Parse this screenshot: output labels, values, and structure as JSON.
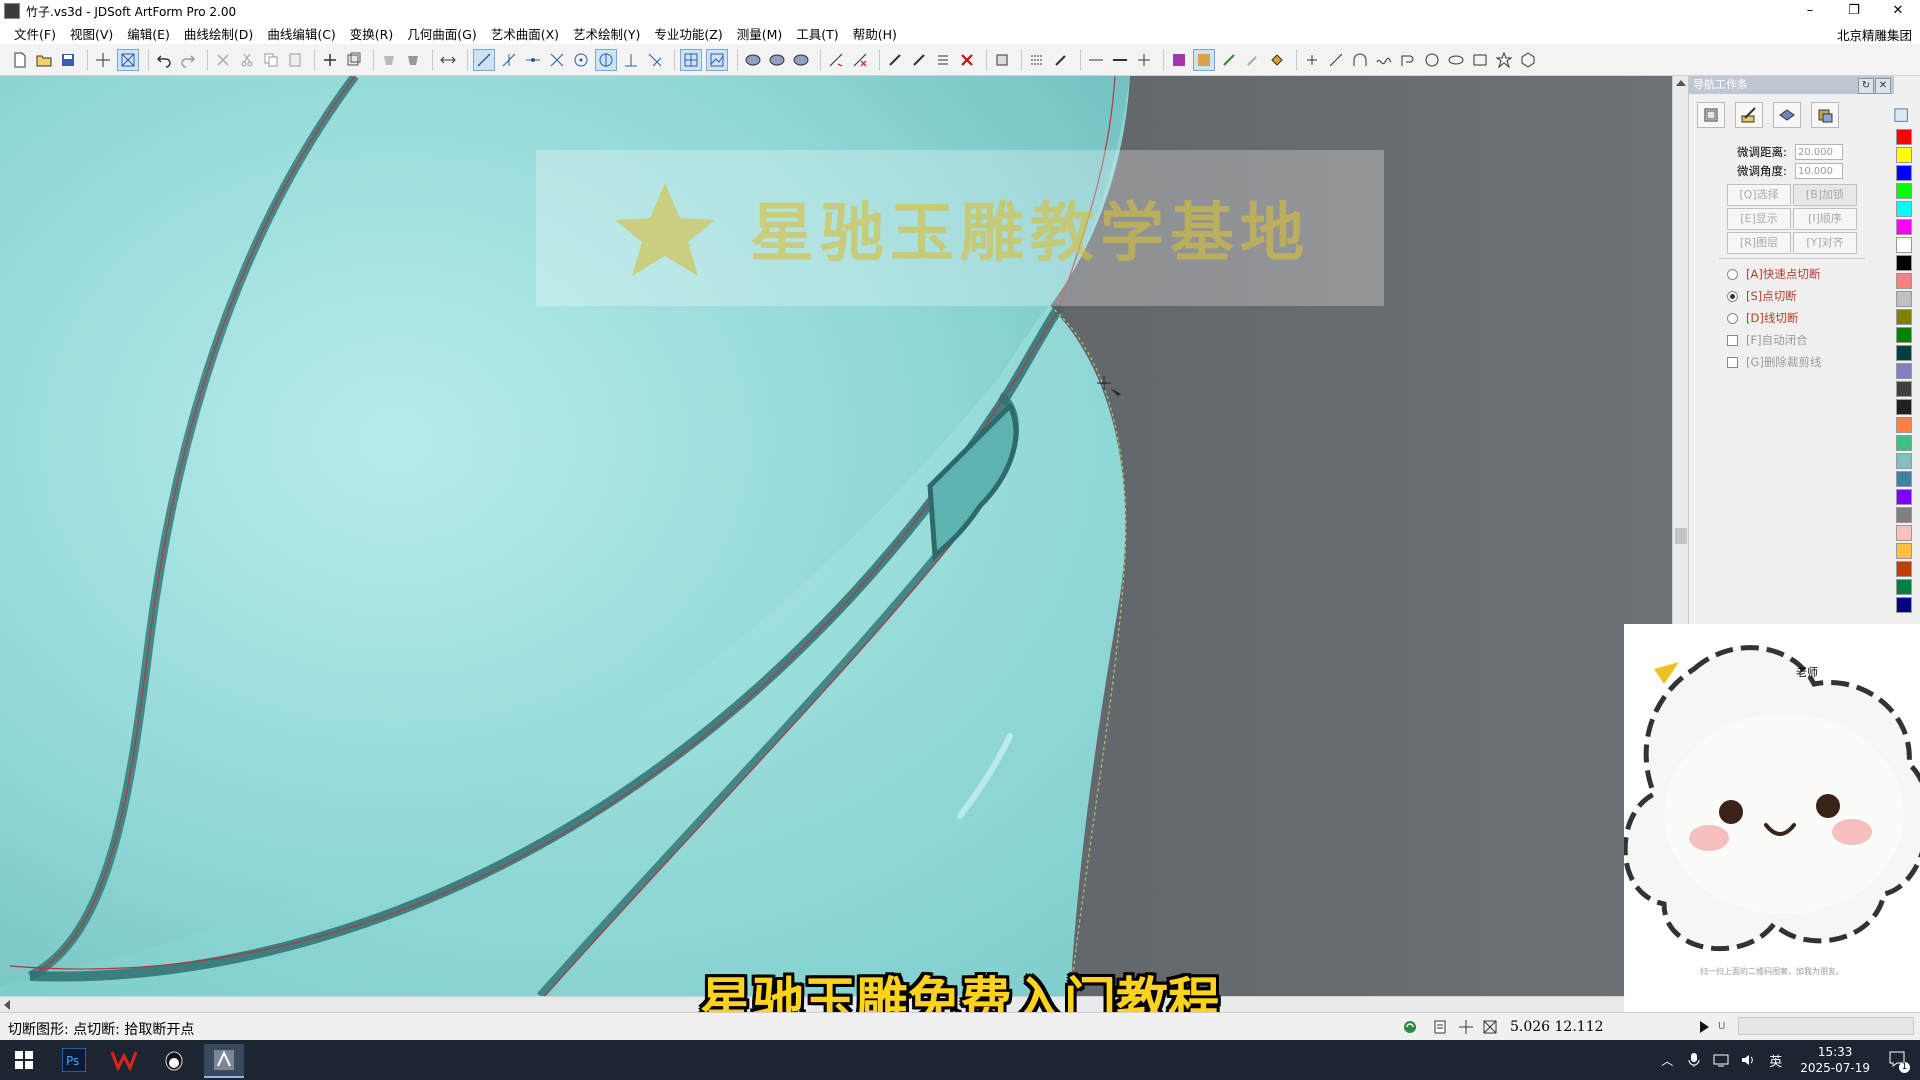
{
  "window": {
    "title": "竹子.vs3d - JDSoft ArtForm Pro 2.00",
    "controls": [
      "–",
      "❐",
      "✕"
    ]
  },
  "menu": {
    "items": [
      "文件(F)",
      "视图(V)",
      "编辑(E)",
      "曲线绘制(D)",
      "曲线编辑(C)",
      "变换(R)",
      "几何曲面(G)",
      "艺术曲面(X)",
      "艺术绘制(Y)",
      "专业功能(Z)",
      "测量(M)",
      "工具(T)",
      "帮助(H)"
    ],
    "company": "北京精雕集团"
  },
  "watermark": {
    "text": "星驰玉雕教学基地"
  },
  "panel": {
    "title": "导航工作条",
    "fields": [
      {
        "label": "微调距离:",
        "value": "20.000"
      },
      {
        "label": "微调角度:",
        "value": "10.000"
      }
    ],
    "buttons": [
      "[Q]选择",
      "[B]加锁",
      "[E]显示",
      "[I]顺序",
      "[R]图层",
      "[Y]对齐"
    ],
    "options": [
      {
        "label": "[A]快速点切断",
        "type": "radio",
        "checked": false,
        "active": true
      },
      {
        "label": "[S]点切断",
        "type": "radio",
        "checked": true,
        "active": true
      },
      {
        "label": "[D]线切断",
        "type": "radio",
        "checked": false,
        "active": true
      },
      {
        "label": "[F]自动闭合",
        "type": "check",
        "checked": false,
        "active": false
      },
      {
        "label": "[G]删除裁剪线",
        "type": "check",
        "checked": false,
        "active": false
      }
    ]
  },
  "palette": [
    "#ff0000",
    "#ffff00",
    "#0000ff",
    "#00ff00",
    "#00ffff",
    "#ff00ff",
    "#ffffff",
    "#000000",
    "#ff8080",
    "#c0c0c0",
    "#808000",
    "#008000",
    "#004040",
    "#8080c0",
    "#404040",
    "#202020",
    "#ff8040",
    "#40c080",
    "#80c0c0",
    "#4080a0",
    "#8000ff",
    "#808080",
    "#ffc0c0",
    "#ffc040",
    "#c04000",
    "#008040",
    "#000080"
  ],
  "teacher": {
    "label": "老师",
    "footer": "扫一扫上面的二维码图案，加我为朋友。"
  },
  "caption": "星驰玉雕免费入门教程",
  "status": {
    "text": "切断图形: 点切断: 拾取断开点",
    "coords": "5.026  12.112",
    "scroll_u": "U"
  },
  "taskbar": {
    "apps": [
      "windows-start",
      "photoshop",
      "wps",
      "wechat",
      "artform"
    ],
    "tray": {
      "ime": "英",
      "time": "15:33",
      "date": "2025-07-19",
      "notif": "1"
    }
  }
}
